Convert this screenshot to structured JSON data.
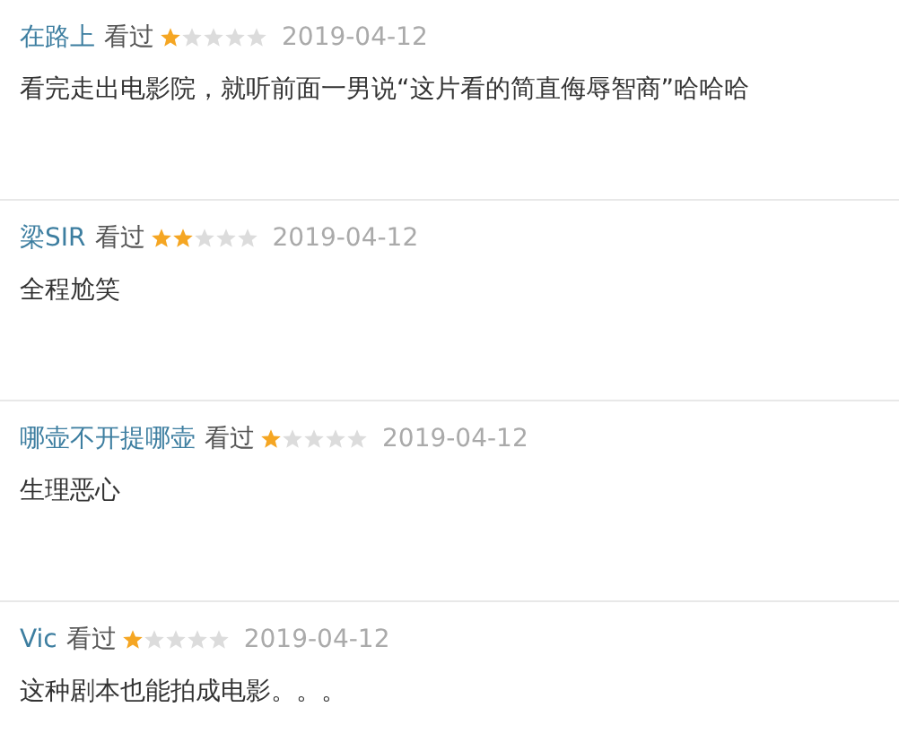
{
  "reviews": [
    {
      "user": "在路上",
      "status": "看过",
      "stars": 1,
      "date": "2019-04-12",
      "comment": "看完走出电影院，就听前面一男说“这片看的简直侮辱智商”哈哈哈"
    },
    {
      "user": "梁SIR",
      "status": "看过",
      "stars": 2,
      "date": "2019-04-12",
      "comment": "全程尬笑"
    },
    {
      "user": "哪壶不开提哪壶",
      "status": "看过",
      "stars": 1,
      "date": "2019-04-12",
      "comment": "生理恶心"
    },
    {
      "user": "Vic",
      "status": "看过",
      "stars": 1,
      "date": "2019-04-12",
      "comment": "这种剧本也能拍成电影。。。"
    }
  ]
}
